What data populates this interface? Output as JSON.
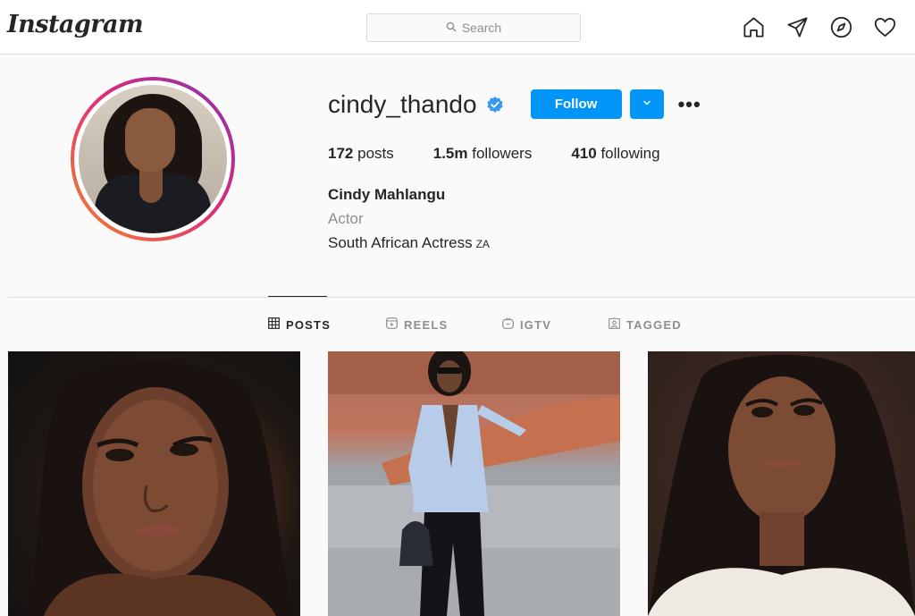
{
  "nav": {
    "logo": "Instagram",
    "search_placeholder": "Search",
    "icons": [
      "home-icon",
      "direct-icon",
      "explore-icon",
      "activity-icon"
    ]
  },
  "profile": {
    "username": "cindy_thando",
    "verified": true,
    "follow_label": "Follow",
    "stats": {
      "posts_count": "172",
      "posts_label": "posts",
      "followers_count": "1.5m",
      "followers_label": "followers",
      "following_count": "410",
      "following_label": "following"
    },
    "full_name": "Cindy Mahlangu",
    "category": "Actor",
    "bio": "South African Actress",
    "bio_flag": "ZA"
  },
  "tabs": [
    {
      "label": "POSTS",
      "icon": "grid-icon",
      "active": true
    },
    {
      "label": "REELS",
      "icon": "reels-icon",
      "active": false
    },
    {
      "label": "IGTV",
      "icon": "igtv-icon",
      "active": false
    },
    {
      "label": "TAGGED",
      "icon": "tagged-icon",
      "active": false
    }
  ],
  "colors": {
    "accent": "#0095f6",
    "text": "#262626",
    "muted": "#8e8e8e",
    "border": "#dbdbdb",
    "background": "#fafafa"
  }
}
